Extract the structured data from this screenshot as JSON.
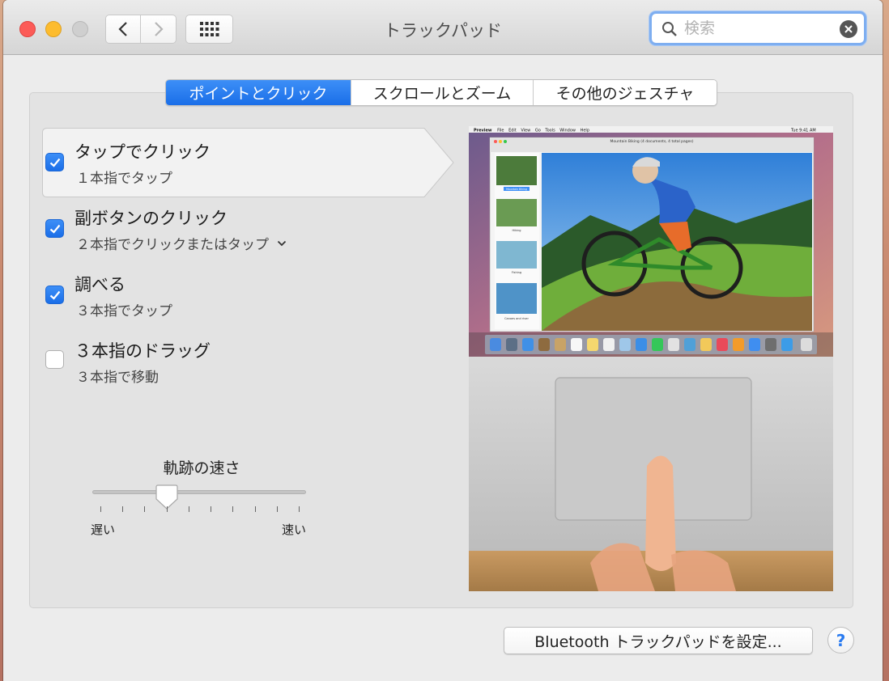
{
  "window": {
    "title": "トラックパッド"
  },
  "search": {
    "placeholder": "検索",
    "value": ""
  },
  "tabs": [
    {
      "label": "ポイントとクリック",
      "active": true
    },
    {
      "label": "スクロールとズーム",
      "active": false
    },
    {
      "label": "その他のジェスチャ",
      "active": false
    }
  ],
  "options": [
    {
      "title": "タップでクリック",
      "subtitle": "１本指でタップ",
      "checked": true
    },
    {
      "title": "副ボタンのクリック",
      "subtitle": "２本指でクリックまたはタップ",
      "checked": true
    },
    {
      "title": "調べる",
      "subtitle": "３本指でタップ",
      "checked": true
    },
    {
      "title": "３本指のドラッグ",
      "subtitle": "３本指で移動",
      "checked": false
    }
  ],
  "tracking_speed": {
    "label": "軌跡の速さ",
    "slow_label": "遅い",
    "fast_label": "速い",
    "value_fraction": 0.35,
    "tick_count": 10
  },
  "preview": {
    "menubar_items": [
      "Preview",
      "File",
      "Edit",
      "View",
      "Go",
      "Tools",
      "Window",
      "Help"
    ],
    "clock": "Tue 9:41 AM",
    "doc_title": "Mountain Biking (4 documents, 4 total pages)",
    "thumbnails": [
      "Mountain Biking",
      "Hiking",
      "Fishing",
      "Canoes and river"
    ]
  },
  "footer": {
    "bluetooth_button": "Bluetooth トラックパッドを設定...",
    "help_label": "?"
  },
  "colors": {
    "accent": "#1a6ee8",
    "close": "#fc5b57",
    "minimize": "#fdbc2e"
  }
}
